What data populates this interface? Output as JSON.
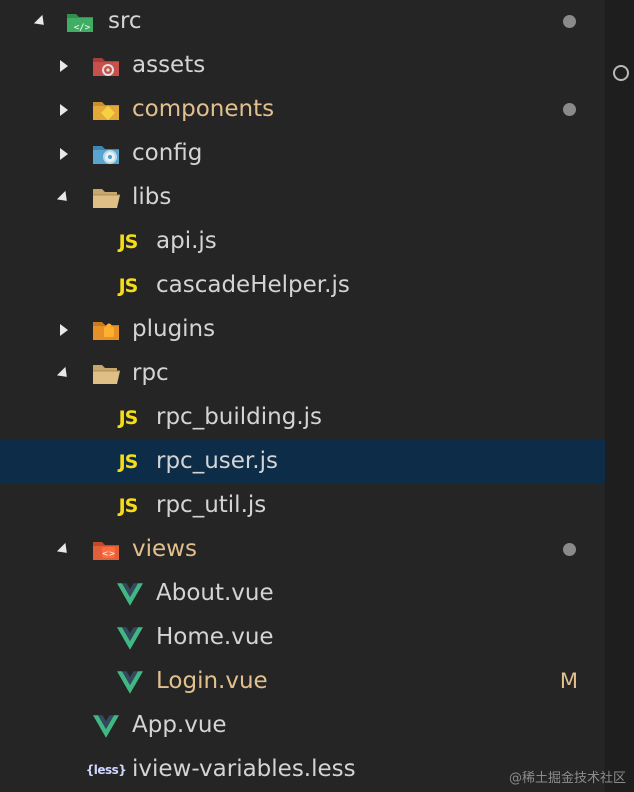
{
  "tree": [
    {
      "name": "src",
      "depth": 0,
      "kind": "folder",
      "expanded": true,
      "icon": "src-folder-icon",
      "modified_dot": true
    },
    {
      "name": "assets",
      "depth": 1,
      "kind": "folder",
      "expanded": false,
      "icon": "assets-folder-icon"
    },
    {
      "name": "components",
      "depth": 1,
      "kind": "folder",
      "expanded": false,
      "icon": "components-folder-icon",
      "modified": true,
      "modified_dot": true
    },
    {
      "name": "config",
      "depth": 1,
      "kind": "folder",
      "expanded": false,
      "icon": "config-folder-icon"
    },
    {
      "name": "libs",
      "depth": 1,
      "kind": "folder",
      "expanded": true,
      "icon": "open-folder-icon"
    },
    {
      "name": "api.js",
      "depth": 2,
      "kind": "js",
      "icon": "js-file-icon"
    },
    {
      "name": "cascadeHelper.js",
      "depth": 2,
      "kind": "js",
      "icon": "js-file-icon"
    },
    {
      "name": "plugins",
      "depth": 1,
      "kind": "folder",
      "expanded": false,
      "icon": "plugins-folder-icon"
    },
    {
      "name": "rpc",
      "depth": 1,
      "kind": "folder",
      "expanded": true,
      "icon": "open-folder-icon"
    },
    {
      "name": "rpc_building.js",
      "depth": 2,
      "kind": "js",
      "icon": "js-file-icon"
    },
    {
      "name": "rpc_user.js",
      "depth": 2,
      "kind": "js",
      "icon": "js-file-icon",
      "selected": true
    },
    {
      "name": "rpc_util.js",
      "depth": 2,
      "kind": "js",
      "icon": "js-file-icon"
    },
    {
      "name": "views",
      "depth": 1,
      "kind": "folder",
      "expanded": true,
      "icon": "views-folder-icon",
      "modified": true,
      "modified_dot": true
    },
    {
      "name": "About.vue",
      "depth": 2,
      "kind": "vue",
      "icon": "vue-file-icon"
    },
    {
      "name": "Home.vue",
      "depth": 2,
      "kind": "vue",
      "icon": "vue-file-icon"
    },
    {
      "name": "Login.vue",
      "depth": 2,
      "kind": "vue",
      "icon": "vue-file-icon",
      "modified": true,
      "badge": "M"
    },
    {
      "name": "App.vue",
      "depth": 1,
      "kind": "vue",
      "icon": "vue-file-icon"
    },
    {
      "name": "iview-variables.less",
      "depth": 1,
      "kind": "less",
      "icon": "less-file-icon",
      "icon_text": "{less}"
    }
  ],
  "watermark": "@稀土掘金技术社区",
  "colors": {
    "background": "#252526",
    "selected_row": "#0c2c47",
    "modified_text": "#e2c08d",
    "js_icon": "#f5de19",
    "vue_green": "#41b883",
    "vue_dark": "#35495e"
  }
}
